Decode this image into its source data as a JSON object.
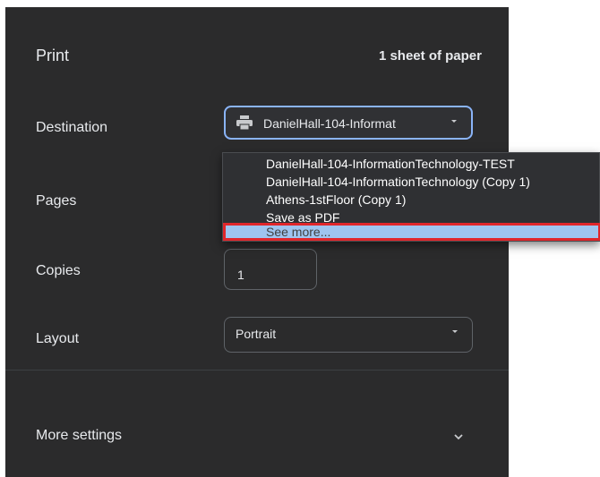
{
  "header": {
    "title": "Print",
    "sheet_count": "1 sheet of paper"
  },
  "destination": {
    "label": "Destination",
    "value": "DanielHall-104-Informat",
    "icon": "printer-icon"
  },
  "dropdown": {
    "options": [
      "DanielHall-104-InformationTechnology-TEST",
      "DanielHall-104-InformationTechnology (Copy 1)",
      "Athens-1stFloor (Copy 1)",
      "Save as PDF",
      "See more..."
    ],
    "highlighted_index": 4,
    "highlight_color": "#e0262b"
  },
  "pages": {
    "label": "Pages"
  },
  "copies": {
    "label": "Copies",
    "value": "1"
  },
  "layout": {
    "label": "Layout",
    "value": "Portrait"
  },
  "more_settings": {
    "label": "More settings"
  },
  "colors": {
    "panel_bg": "#2b2b2c",
    "focus_border": "#8ab4f8",
    "selected_option_bg": "#9fc4ef"
  }
}
